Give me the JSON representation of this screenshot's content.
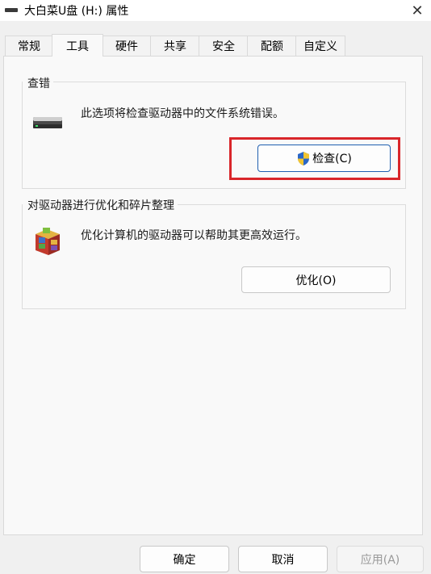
{
  "window": {
    "title": "大白菜U盘 (H:) 属性",
    "close_glyph": "✕"
  },
  "tabs": [
    {
      "label": "常规",
      "active": false
    },
    {
      "label": "工具",
      "active": true
    },
    {
      "label": "硬件",
      "active": false
    },
    {
      "label": "共享",
      "active": false
    },
    {
      "label": "安全",
      "active": false
    },
    {
      "label": "配额",
      "active": false
    },
    {
      "label": "自定义",
      "active": false
    }
  ],
  "error_check": {
    "group_label": "查错",
    "description": "此选项将检查驱动器中的文件系统错误。",
    "button_label": "检查(C)",
    "icon": "drive-icon"
  },
  "optimize": {
    "group_label": "对驱动器进行优化和碎片整理",
    "description": "优化计算机的驱动器可以帮助其更高效运行。",
    "button_label": "优化(O)",
    "icon": "defrag-icon"
  },
  "footer": {
    "ok_label": "确定",
    "cancel_label": "取消",
    "apply_label": "应用(A)"
  },
  "colors": {
    "highlight": "#d9262a",
    "primary_border": "#1f5fb0"
  }
}
